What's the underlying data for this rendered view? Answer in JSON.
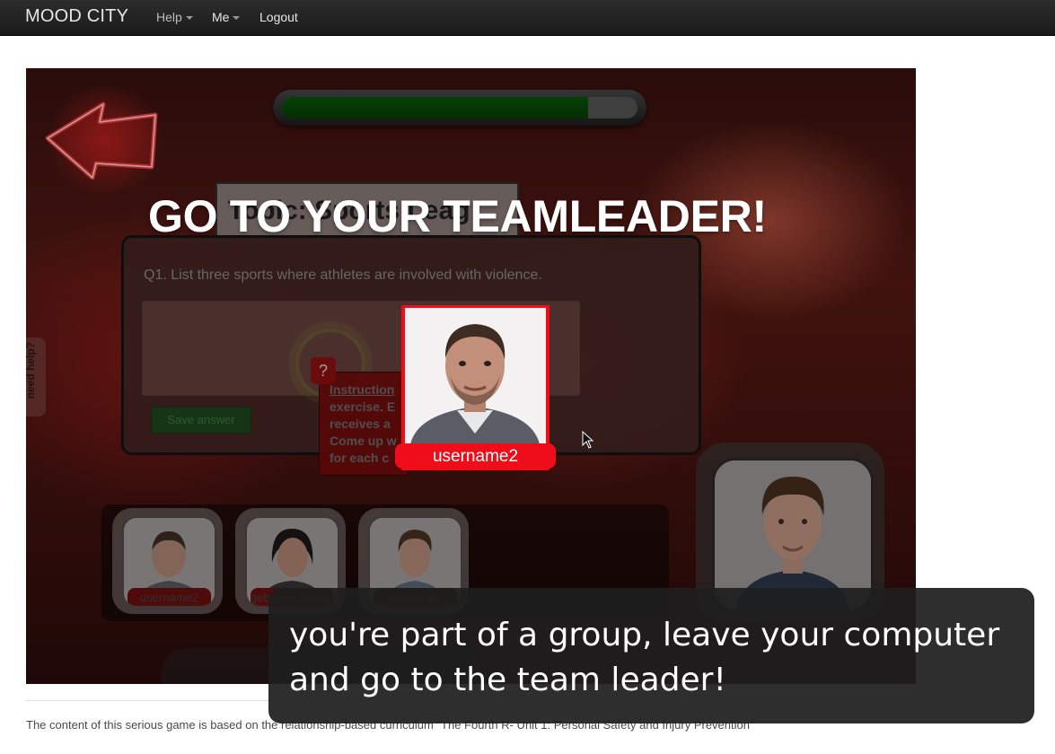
{
  "navbar": {
    "brand": "MOOD CITY",
    "menu": [
      {
        "label": "Help",
        "has_caret": true
      },
      {
        "label": "Me",
        "has_caret": true
      },
      {
        "label": "Logout",
        "has_caret": false
      }
    ]
  },
  "game": {
    "progress_fraction": 0.86,
    "topic_label": "Topic: Sports Leag",
    "overlay_title": "GO TO YOUR TEAMLEADER!",
    "question": "Q1. List three sports where athletes are involved with violence.",
    "answer_value": "",
    "save_button_label": "Save answer",
    "help_tab_label": "need help?",
    "instructions": {
      "badge": "?",
      "title": "Instruction",
      "lines": [
        "exercise. E",
        "receives a",
        "Come up w",
        "for each c"
      ]
    },
    "popup_username": "username2",
    "members": [
      {
        "name": "username2"
      },
      {
        "name": "gebruikersnaam"
      },
      {
        "name": "username1"
      }
    ]
  },
  "caption": {
    "line1": "you're part of a group, leave your computer",
    "line2": "and go to the team leader!"
  },
  "footer": {
    "text": "The content of this serious game is based on the relationship-based curriculum \"The Fourth R- Unit 1: Personal Safety and Injury Prevention\""
  },
  "colors": {
    "navbar_bg": "#222222",
    "popup_red": "#ef0d1a",
    "progress_green": "#0a5a0a",
    "caption_bg": "#1e1e1e"
  },
  "icons": [
    "back-arrow-icon",
    "caret-down-icon",
    "question-icon",
    "mouse-cursor-icon"
  ]
}
